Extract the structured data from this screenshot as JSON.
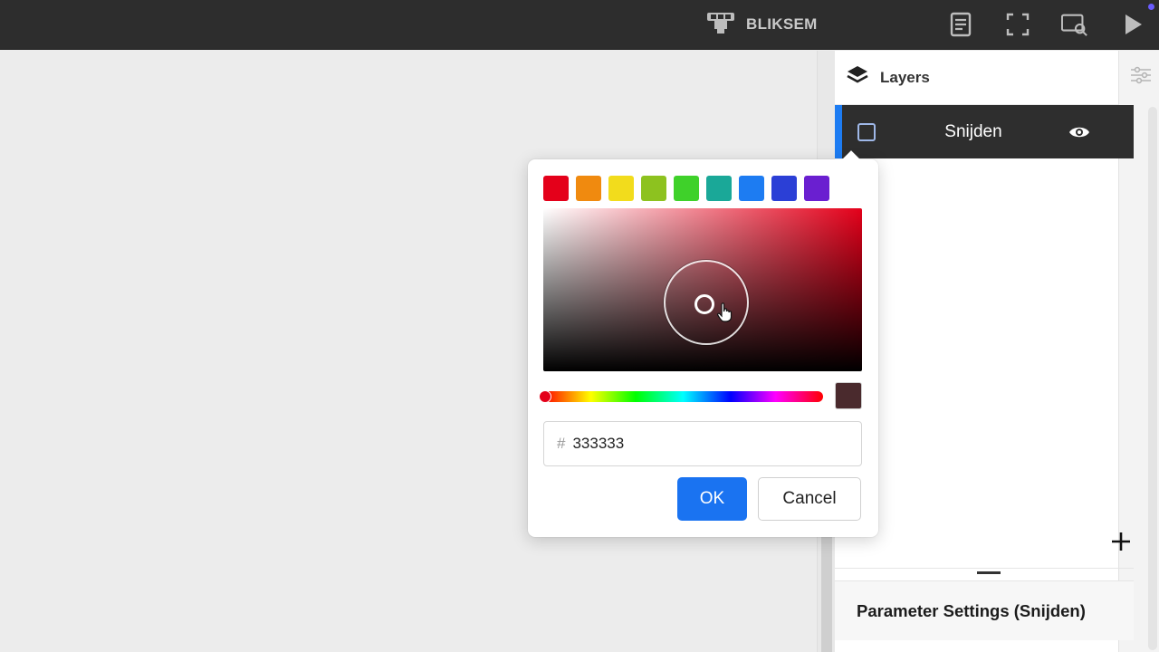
{
  "app": {
    "brand_name": "BLIKSEM"
  },
  "toolbar": {
    "icons": [
      "notes-icon",
      "fullscreen-icon",
      "preview-icon",
      "play-icon"
    ]
  },
  "layers_panel": {
    "title": "Layers",
    "layers": [
      {
        "name": "Snijden",
        "visible": true,
        "selected": true
      }
    ]
  },
  "parameter_settings": {
    "title": "Parameter Settings (Snijden)"
  },
  "color_picker": {
    "preset_colors": [
      "#e4001a",
      "#f08a0f",
      "#f2dc1c",
      "#8dc21f",
      "#3fd12a",
      "#1aa898",
      "#1d7cf2",
      "#2b3fd6",
      "#6a1fd0"
    ],
    "hex_prefix": "#",
    "hex_value": "333333",
    "preview_color": "#4a2a2d",
    "hue_color": "#e4001a",
    "ok_label": "OK",
    "cancel_label": "Cancel"
  },
  "colors": {
    "accent": "#1a73f1",
    "topbar": "#2d2d2d",
    "selected_row": "#2e2e2e"
  }
}
